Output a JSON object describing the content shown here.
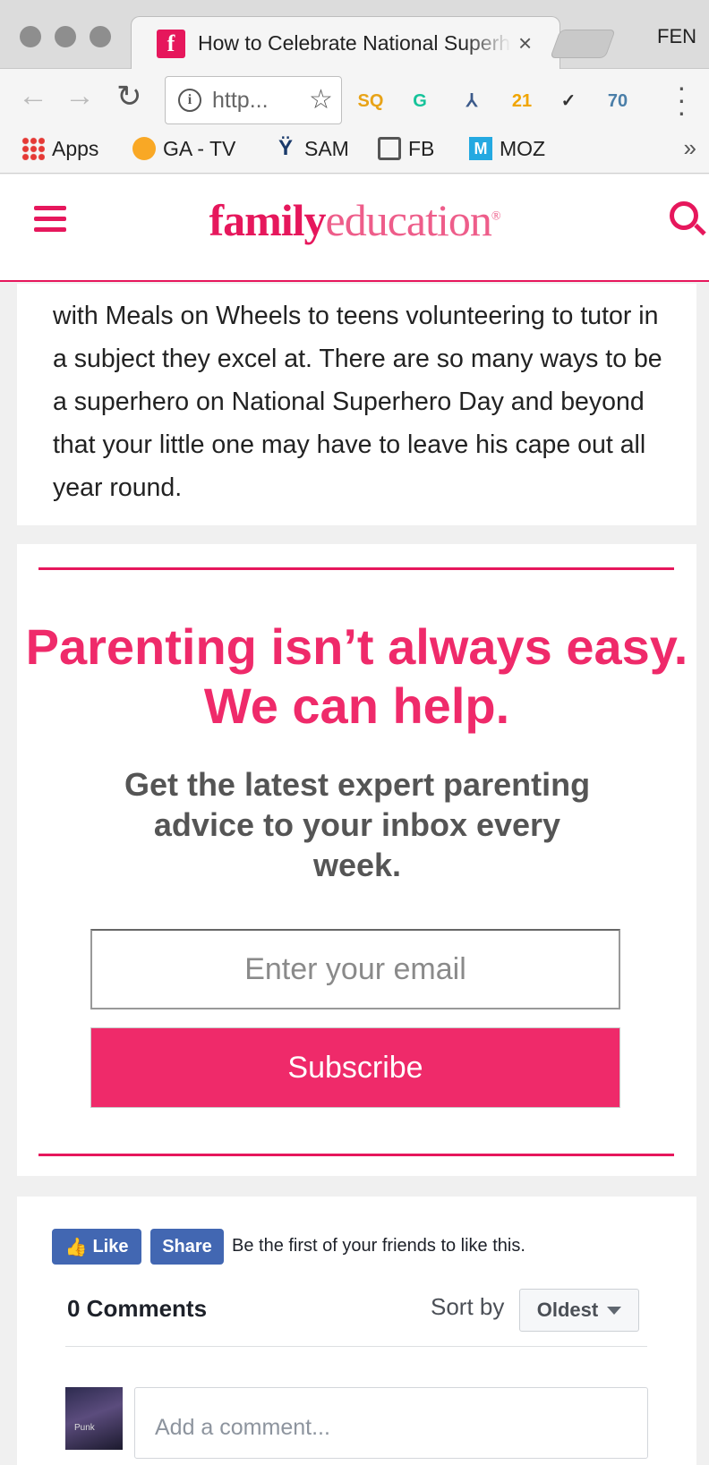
{
  "browser": {
    "tab_title": "How to Celebrate National Superhero Day",
    "tab_favicon": "f",
    "profile": "FEN",
    "url": "http...",
    "extensions": [
      {
        "name": "sq-extension-icon",
        "label": "SQ",
        "color": "#e8a317"
      },
      {
        "name": "grammarly-icon",
        "label": "G",
        "color": "#15c39a"
      },
      {
        "name": "git-branch-icon",
        "label": "⅄",
        "color": "#3c5a8a"
      },
      {
        "name": "ghostery-icon",
        "label": "21",
        "color": "#f0a500"
      },
      {
        "name": "checkmark-extension-icon",
        "label": "✓",
        "color": "#333333"
      },
      {
        "name": "page-score-icon",
        "label": "70",
        "color": "#4a7ea8"
      }
    ],
    "bookmarks": [
      {
        "label": "Apps",
        "icon": "apps-grid-icon"
      },
      {
        "label": "GA - TV",
        "icon": "analytics-icon"
      },
      {
        "label": "SAM",
        "icon": "sam-icon"
      },
      {
        "label": "FB",
        "icon": "folder-icon"
      },
      {
        "label": "MOZ",
        "icon": "moz-icon"
      }
    ],
    "more": "»"
  },
  "site": {
    "logo_family": "family",
    "logo_education": "education",
    "logo_mark": "®",
    "accent": "#e6175c"
  },
  "article": {
    "text": "with Meals on Wheels to teens volunteering to tutor in a subject they excel at. There are so many ways to be a superhero on National Superhero Day and beyond that your little one may have to leave his cape out all year round."
  },
  "newsletter": {
    "headline": "Parenting isn’t always easy. We can help.",
    "subtext": "Get the latest expert parenting advice to your inbox every week.",
    "email_placeholder": "Enter your email",
    "subscribe_label": "Subscribe"
  },
  "comments": {
    "like_label": "Like",
    "share_label": "Share",
    "social_text": "Be the first of your friends to like this.",
    "count_label": "0 Comments",
    "sort_label": "Sort by",
    "sort_value": "Oldest",
    "avatar_caption": "Punk",
    "input_placeholder": "Add a comment..."
  }
}
